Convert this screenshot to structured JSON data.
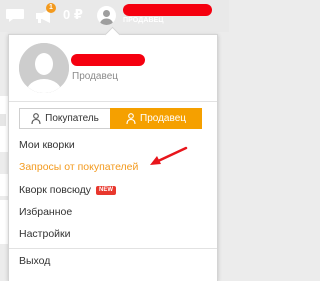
{
  "topbar": {
    "notif_count": "1",
    "balance": "0 ₽",
    "role_label": "ПРОДАВЕЦ"
  },
  "profile": {
    "role": "Продавец"
  },
  "role_switch": {
    "buyer_label": "Покупатель",
    "seller_label": "Продавец",
    "active": "seller"
  },
  "menu": {
    "items": [
      {
        "label": "Мои кворки"
      },
      {
        "label": "Запросы от покупателей"
      },
      {
        "label": "Кворк повсюду",
        "badge": "NEW"
      },
      {
        "label": "Избранное"
      },
      {
        "label": "Настройки"
      }
    ],
    "logout": "Выход"
  },
  "colors": {
    "accent": "#f5a000",
    "active_link": "#f39a1e",
    "redaction": "#f5000f",
    "badge": "#e8372d"
  }
}
